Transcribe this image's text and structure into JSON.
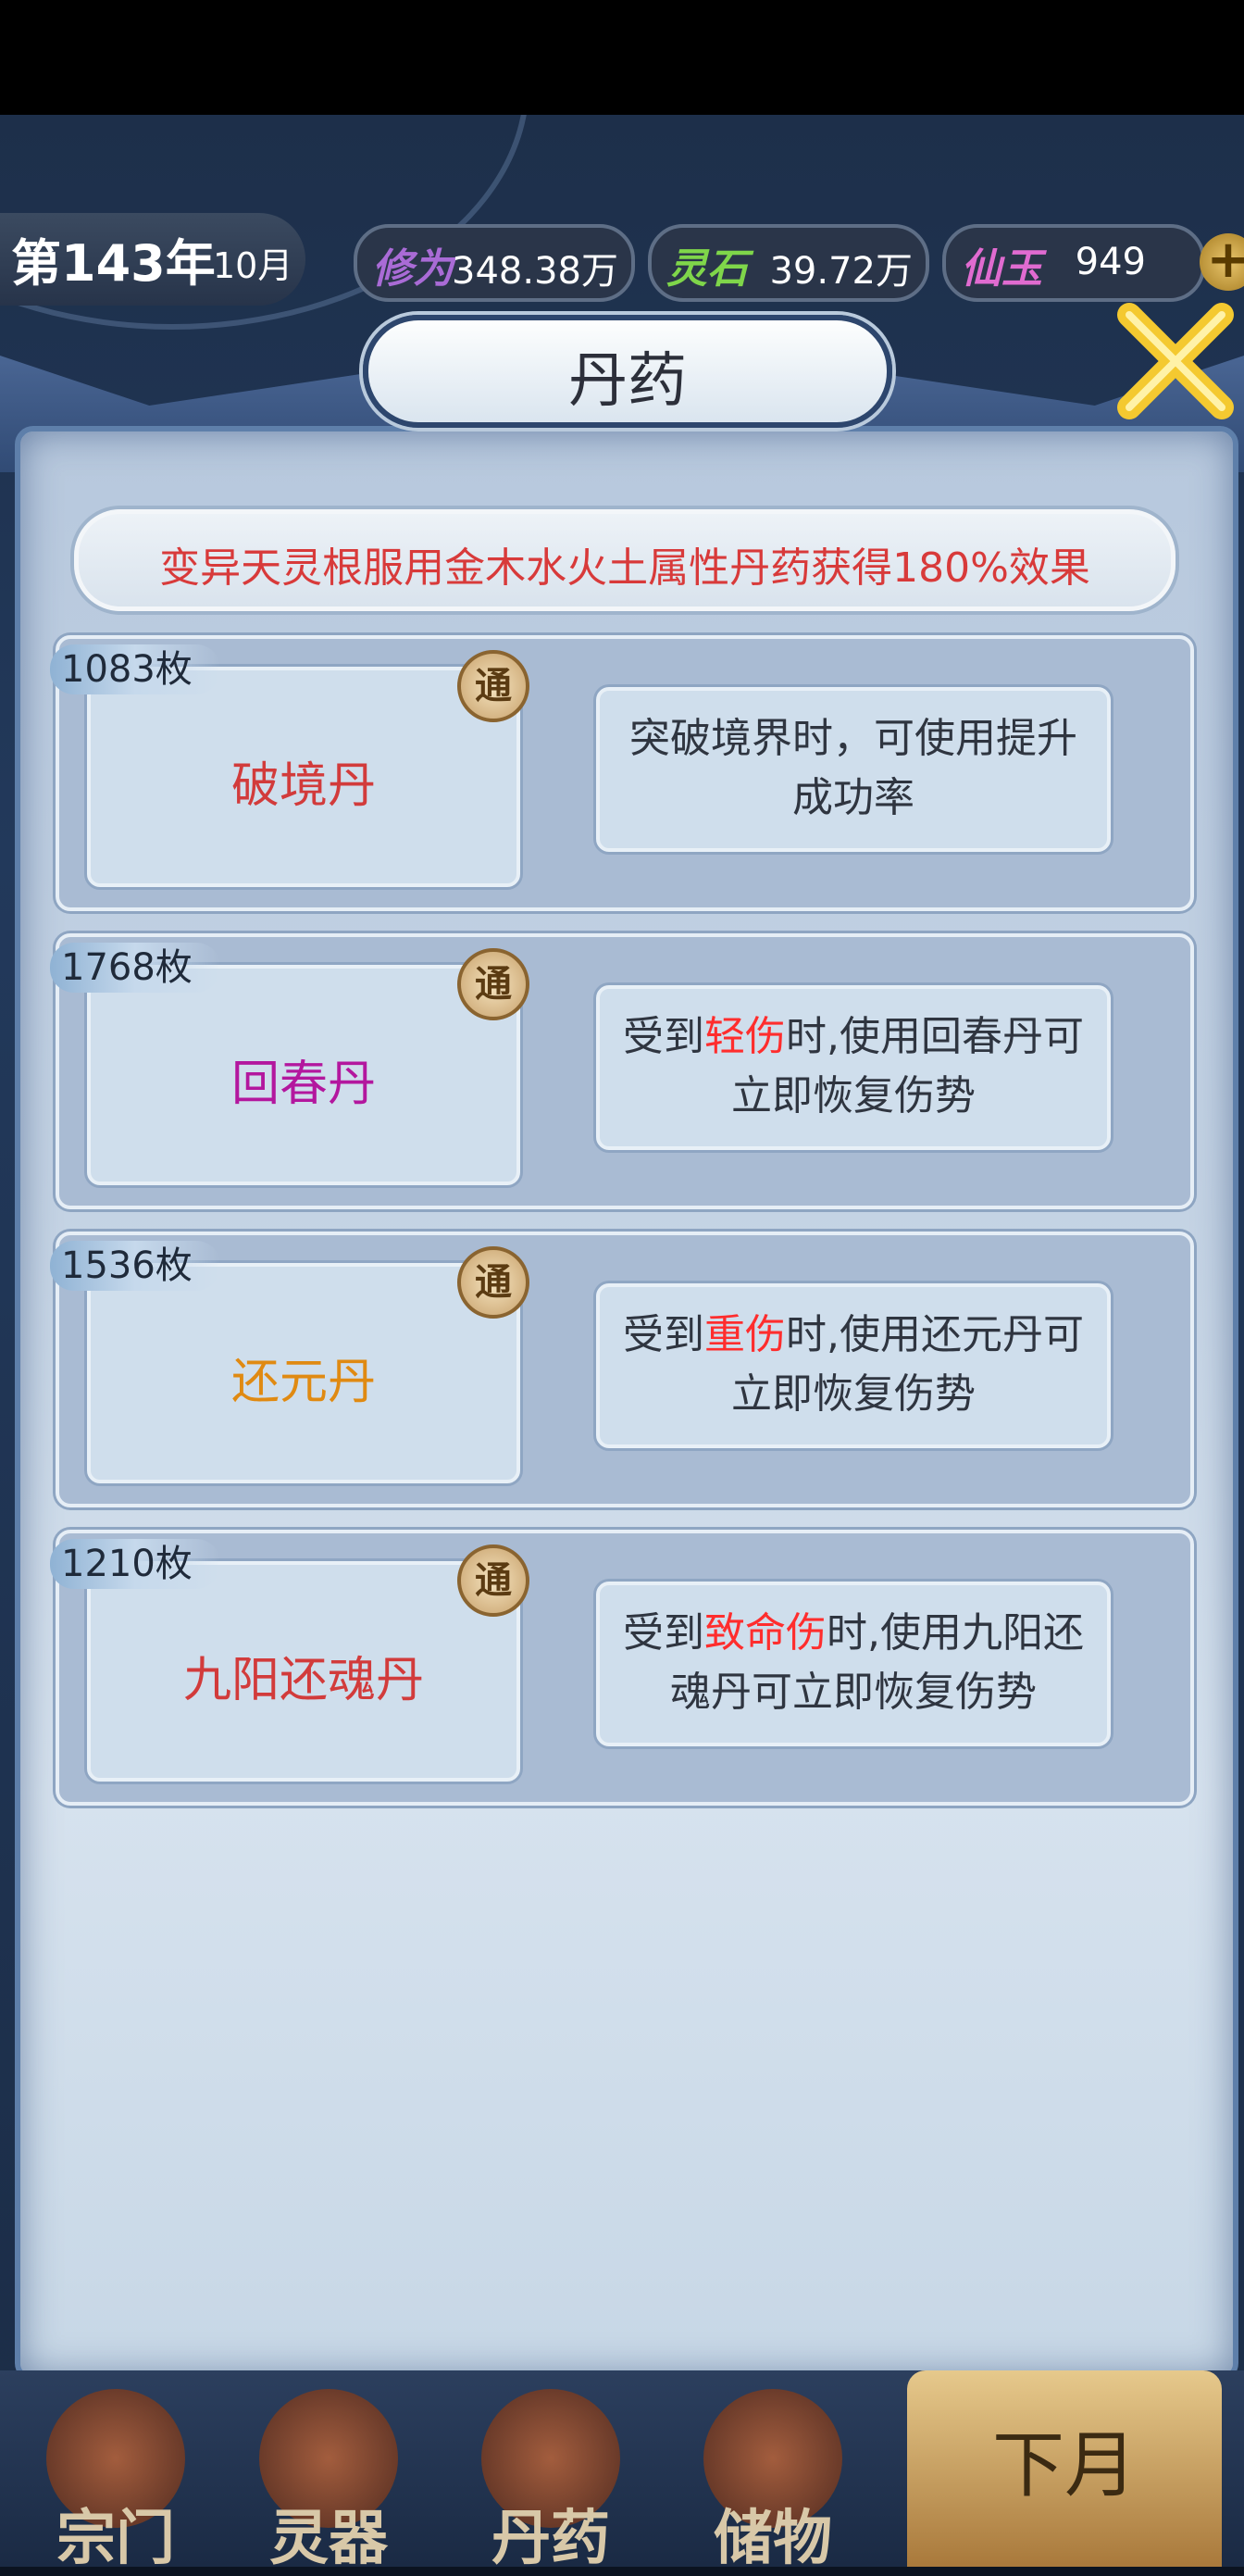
{
  "topbar": {
    "year_label": "第143年",
    "month_label": "10月",
    "resources": [
      {
        "label": "修为",
        "value": "348.38万",
        "color": "#a96bd6"
      },
      {
        "label": "灵石",
        "value": "39.72万",
        "color": "#7fd64a"
      },
      {
        "label": "仙玉",
        "value": "949",
        "color": "#e06bd0"
      }
    ],
    "plus_icon": "plus-icon",
    "close_icon": "close-icon"
  },
  "title": "丹药",
  "tip": "变异天灵根服用金木水火土属性丹药获得180%效果",
  "items": [
    {
      "count": "1083枚",
      "badge": "通",
      "name": "破境丹",
      "name_color": "#d23b3b",
      "desc_pre": "突破境界时，可使用提升成功率",
      "desc_red": "",
      "desc_post": ""
    },
    {
      "count": "1768枚",
      "badge": "通",
      "name": "回春丹",
      "name_color": "#b3179e",
      "desc_pre": "受到",
      "desc_red": "轻伤",
      "desc_post": "时,使用回春丹可立即恢复伤势"
    },
    {
      "count": "1536枚",
      "badge": "通",
      "name": "还元丹",
      "name_color": "#e08a12",
      "desc_pre": "受到",
      "desc_red": "重伤",
      "desc_post": "时,使用还元丹可立即恢复伤势"
    },
    {
      "count": "1210枚",
      "badge": "通",
      "name": "九阳还魂丹",
      "name_color": "#d23b3b",
      "desc_pre": "受到",
      "desc_red": "致命伤",
      "desc_post": "时,使用九阳还魂丹可立即恢复伤势"
    }
  ],
  "bottom_nav": [
    {
      "label": "宗门"
    },
    {
      "label": "灵器"
    },
    {
      "label": "丹药"
    },
    {
      "label": "储物"
    }
  ],
  "next_month_label": "下月"
}
